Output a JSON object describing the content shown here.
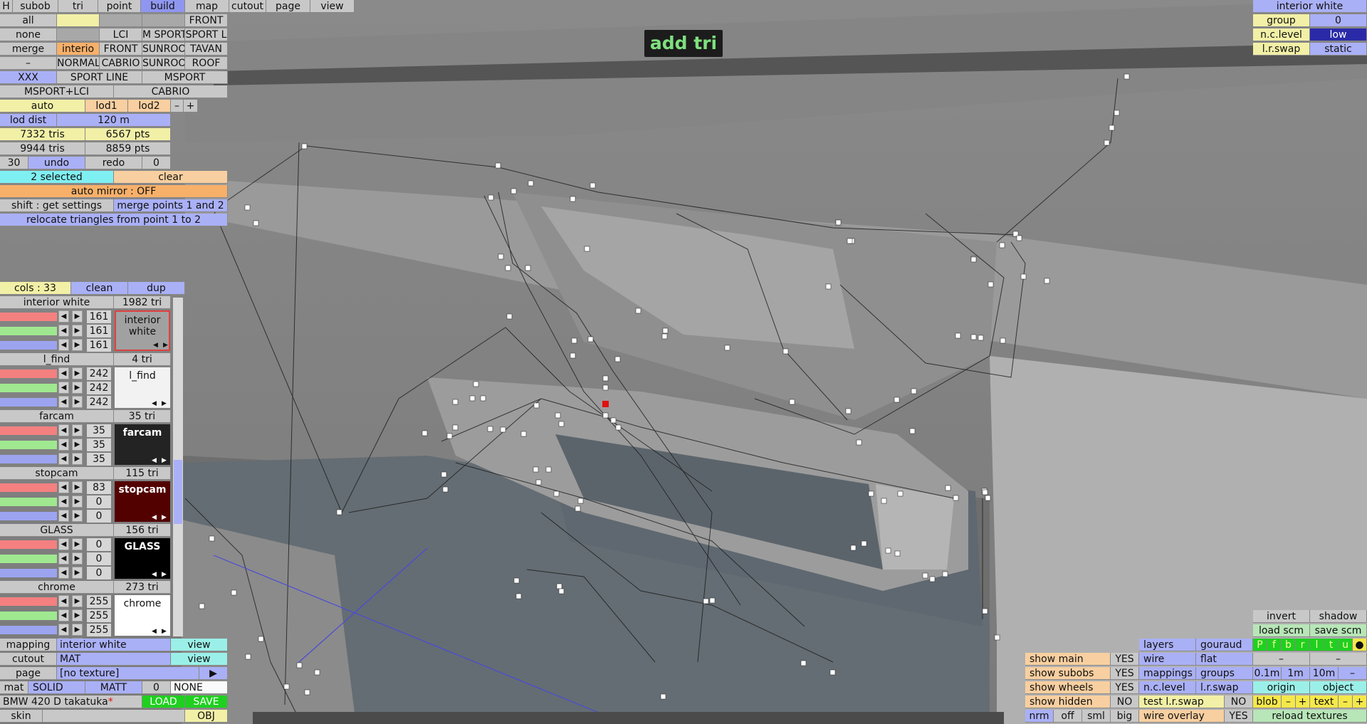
{
  "tool_label": "add tri",
  "top_tabs": [
    "H",
    "subob",
    "tri",
    "point",
    "build",
    "map",
    "cutout",
    "page",
    "view"
  ],
  "rows": {
    "r1": [
      "all",
      "FRONT"
    ],
    "r2": [
      "none",
      "LCI",
      "M SPORT",
      "SPORT L"
    ],
    "r3": [
      "merge",
      "interio",
      "FRONT",
      "SUNROOF",
      "TAVAN"
    ],
    "r4": [
      "–",
      "NORMALL",
      "CABRIO",
      "SUNROOF",
      "ROOF"
    ],
    "r5": [
      "XXX",
      "SPORT LINE",
      "MSPORT"
    ],
    "r6": [
      "MSPORT+LCI",
      "CABRIO"
    ],
    "r7": [
      "auto",
      "lod1",
      "lod2",
      "–",
      "+"
    ]
  },
  "stats": {
    "lod_dist_label": "lod dist",
    "lod_dist": "120 m",
    "tris1": "7332 tris",
    "pts1": "6567 pts",
    "tris2": "9944 tris",
    "pts2": "8859 pts",
    "undo_count": "30",
    "undo": "undo",
    "redo": "redo",
    "redo_count": "0"
  },
  "selection": {
    "selected": "2 selected",
    "clear": "clear",
    "auto_mirror": "auto mirror : OFF",
    "shift_hint": "shift : get settings",
    "merge": "merge points 1 and 2",
    "relocate": "relocate triangles from point 1 to 2"
  },
  "colors_header": {
    "cols": "cols : 33",
    "clean": "clean",
    "dup": "dup"
  },
  "materials": [
    {
      "name": "interior white",
      "tri": "1982 tri",
      "r": "161",
      "g": "161",
      "b": "161",
      "preview": "interior white",
      "bg": "#a1a1a1",
      "fg": "#111111"
    },
    {
      "name": "l_find",
      "tri": "4 tri",
      "r": "242",
      "g": "242",
      "b": "242",
      "preview": "l_find",
      "bg": "#f2f2f2",
      "fg": "#111111"
    },
    {
      "name": "farcam",
      "tri": "35 tri",
      "r": "35",
      "g": "35",
      "b": "35",
      "preview": "farcam",
      "bg": "#232323",
      "fg": "#ffffff"
    },
    {
      "name": "stopcam",
      "tri": "115 tri",
      "r": "83",
      "g": "0",
      "b": "0",
      "preview": "stopcam",
      "bg": "#530000",
      "fg": "#ffffff"
    },
    {
      "name": "GLASS",
      "tri": "156 tri",
      "r": "0",
      "g": "0",
      "b": "0",
      "preview": "GLASS",
      "bg": "#000000",
      "fg": "#ffffff"
    },
    {
      "name": "chrome",
      "tri": "273 tri",
      "r": "255",
      "g": "255",
      "b": "255",
      "preview": "chrome",
      "bg": "#ffffff",
      "fg": "#111111"
    }
  ],
  "bottom_left": {
    "mapping": "mapping",
    "mapping_val": "interior white",
    "view1": "view",
    "cutout": "cutout",
    "cutout_val": "MAT",
    "view2": "view",
    "page": "page",
    "page_val": "[no texture]",
    "page_arrow": "▶",
    "mat": "mat",
    "solid": "SOLID",
    "matt": "MATT",
    "zero": "0",
    "none": "NONE",
    "model": "BMW 420 D takatuka",
    "star": "*",
    "load": "LOAD",
    "save": "SAVE",
    "skin": "skin",
    "obj": "OBJ"
  },
  "top_right": {
    "title": "interior white",
    "group": "group",
    "group_val": "0",
    "nclevel": "n.c.level",
    "nclevel_val": "low",
    "lrswap": "l.r.swap",
    "lrswap_val": "static"
  },
  "bottom_right": {
    "invert": "invert",
    "shadow": "shadow",
    "load_scm": "load scm",
    "save_scm": "save scm",
    "layers": "layers",
    "gouraud": "gouraud",
    "wire": "wire",
    "flat": "flat",
    "mappings": "mappings",
    "groups": "groups",
    "nclevel": "n.c.level",
    "lrswap": "l.r.swap",
    "test_lrswap": "test l.r.swap",
    "test_no": "NO",
    "wire_overlay": "wire overlay",
    "wire_yes": "YES",
    "show_main": "show main",
    "show_main_v": "YES",
    "show_subobs": "show subobs",
    "show_subobs_v": "YES",
    "show_wheels": "show wheels",
    "show_wheels_v": "YES",
    "show_hidden": "show hidden",
    "show_hidden_v": "NO",
    "nrm": "nrm",
    "off": "off",
    "sml": "sml",
    "big": "big",
    "layer_letters": [
      "P",
      "f",
      "b",
      "r",
      "l",
      "t",
      "u"
    ],
    "layer_dot": "●",
    "dash1": "–",
    "dash2": "–",
    "d01": "0.1m",
    "d1": "1m",
    "d10": "10m",
    "dminus": "–",
    "origin": "origin",
    "object": "object",
    "blob": "blob",
    "bminus": "–",
    "bplus": "+",
    "text": "text",
    "tminus": "–",
    "tplus": "+",
    "reload": "reload textures"
  }
}
